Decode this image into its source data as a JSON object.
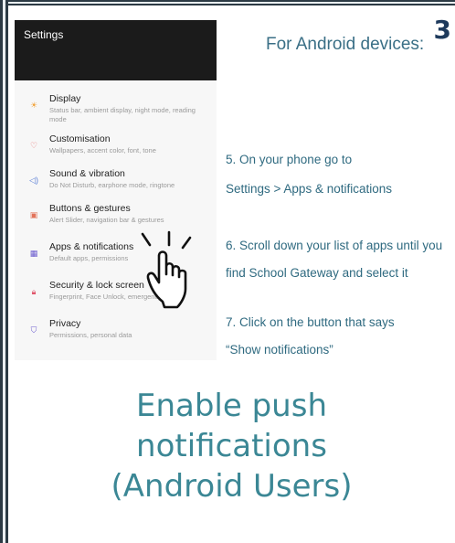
{
  "slide_number": "3",
  "phone": {
    "header_title": "Settings",
    "items": [
      {
        "title": "Display",
        "subtitle": "Status bar, ambient display, night mode, reading mode",
        "icon": "sun-icon",
        "color": "#f2a33a"
      },
      {
        "title": "Customisation",
        "subtitle": "Wallpapers, accent color, font, tone",
        "icon": "shirt-icon",
        "color": "#e56b6b"
      },
      {
        "title": "Sound & vibration",
        "subtitle": "Do Not Disturb, earphone mode, ringtone",
        "icon": "speaker-icon",
        "color": "#5b7fd6"
      },
      {
        "title": "Buttons & gestures",
        "subtitle": "Alert Slider, navigation bar & gestures",
        "icon": "gesture-icon",
        "color": "#e2735a"
      },
      {
        "title": "Apps & notifications",
        "subtitle": "Default apps, permissions",
        "icon": "grid-icon",
        "color": "#6a5acd"
      },
      {
        "title": "Security & lock screen",
        "subtitle": "Fingerprint, Face Unlock, emergency rescue",
        "icon": "lock-icon",
        "color": "#e0566b"
      },
      {
        "title": "Privacy",
        "subtitle": "Permissions, personal data",
        "icon": "shield-icon",
        "color": "#6a5acd"
      }
    ]
  },
  "instructions": {
    "heading": "For Android devices:",
    "step5_line1": "5. On your phone go to",
    "step5_line2": "Settings > Apps & notifications",
    "step6_line1": "6. Scroll down your list of apps until you",
    "step6_line2": "find School Gateway and select it",
    "step7_line1": "7. Click on the button that says",
    "step7_line2": "“Show notifications”"
  },
  "caption": {
    "line1": "Enable push",
    "line2": "notifications",
    "line3": "(Android Users)"
  }
}
